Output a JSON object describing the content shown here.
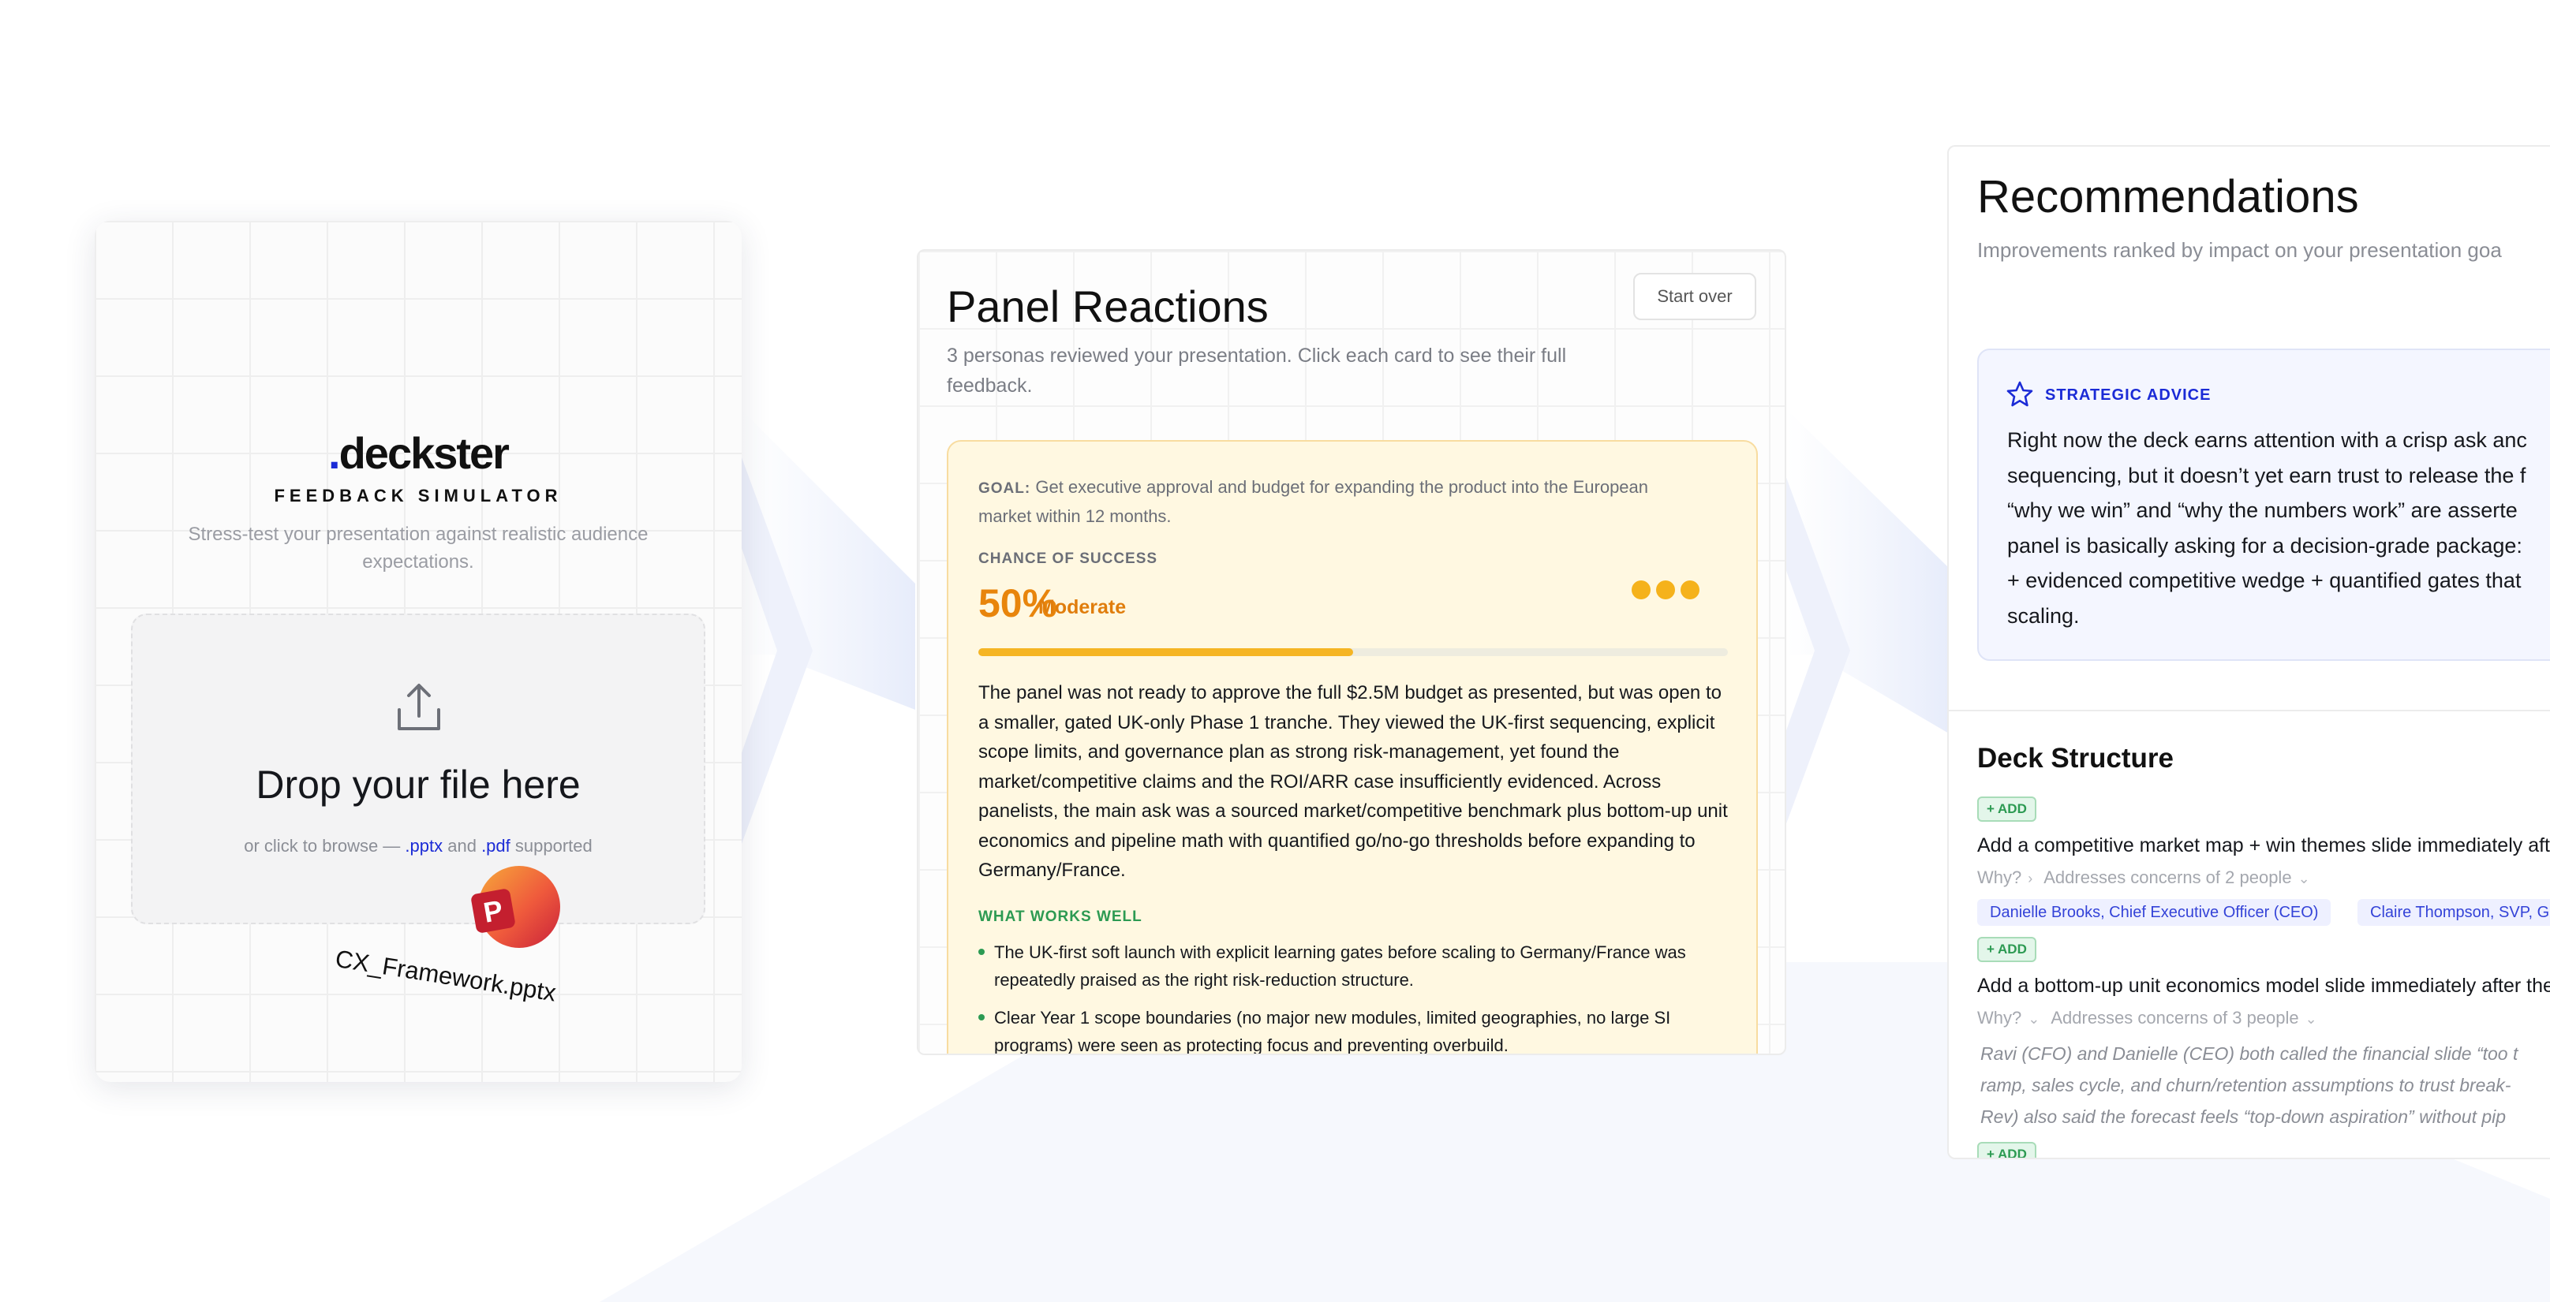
{
  "upload": {
    "logo_dot": ".",
    "logo_word": "deckster",
    "tagline": "FEEDBACK SIMULATOR",
    "subtitle": "Stress-test your presentation against realistic audience expectations.",
    "dropzone": {
      "title": "Drop your file here",
      "hint_prefix": "or click to browse — ",
      "ext1": ".pptx",
      "hint_mid": " and ",
      "ext2": ".pdf",
      "hint_suffix": " supported"
    },
    "file_name": "CX_Framework.pptx",
    "file_icon": "powerpoint-icon"
  },
  "panel_reactions": {
    "title": "Panel Reactions",
    "start_over": "Start over",
    "subtitle": "3 personas reviewed your presentation. Click each card to see their full feedback.",
    "goal_label": "GOAL:",
    "goal_text": "Get executive approval and budget for expanding the product into the European market within 12 months.",
    "chance_label": "CHANCE OF SUCCESS",
    "chance_value": "50%",
    "chance_fraction": 0.5,
    "chance_level": "Moderate",
    "summary": "The panel was not ready to approve the full $2.5M budget as presented, but was open to a smaller, gated UK-only Phase 1 tranche. They viewed the UK-first sequencing, explicit scope limits, and governance plan as strong risk-management, yet found the market/competitive claims and the ROI/ARR case insufficiently evidenced. Across panelists, the main ask was a sourced market/competitive benchmark plus bottom-up unit economics and pipeline math with quantified go/no-go thresholds before expanding to Germany/France.",
    "works_label": "WHAT WORKS WELL",
    "works_items": [
      "The UK-first soft launch with explicit learning gates before scaling to Germany/France was repeatedly praised as the right risk-reduction structure.",
      "Clear Year 1 scope boundaries (no major new modules, limited geographies, no large SI programs) were seen as protecting focus and preventing overbuild."
    ],
    "accent_color": "#f5b21b"
  },
  "recommendations": {
    "title": "Recommendations",
    "subtitle": "Improvements ranked by impact on your presentation goa",
    "advice_label": "STRATEGIC ADVICE",
    "advice_lines": [
      "Right now the deck earns attention with a crisp ask anc",
      "sequencing, but it doesn’t yet earn trust to release the f",
      "“why we win” and “why the numbers work” are asserte",
      "panel is basically asking for a decision-grade package:",
      "+ evidenced competitive wedge + quantified gates that",
      "scaling."
    ],
    "deck_structure_title": "Deck Structure",
    "add_label": "+ ADD",
    "why_label": "Why?",
    "items": [
      {
        "text": "Add a competitive market map + win themes slide immediately afte",
        "concerns": "Addresses concerns of 2 people",
        "people": [
          "Danielle Brooks, Chief Executive Officer (CEO)",
          "Claire Thompson, SVP, Gl"
        ]
      },
      {
        "text": "Add a bottom-up unit economics model slide immediately after the",
        "concerns": "Addresses concerns of 3 people",
        "quote_lines": [
          "Ravi (CFO) and Danielle (CEO) both called the financial slide “too t",
          "ramp, sales cycle, and churn/retention assumptions to trust break-",
          "Rev) also said the forecast feels “top-down aspiration” without pip"
        ]
      }
    ]
  }
}
